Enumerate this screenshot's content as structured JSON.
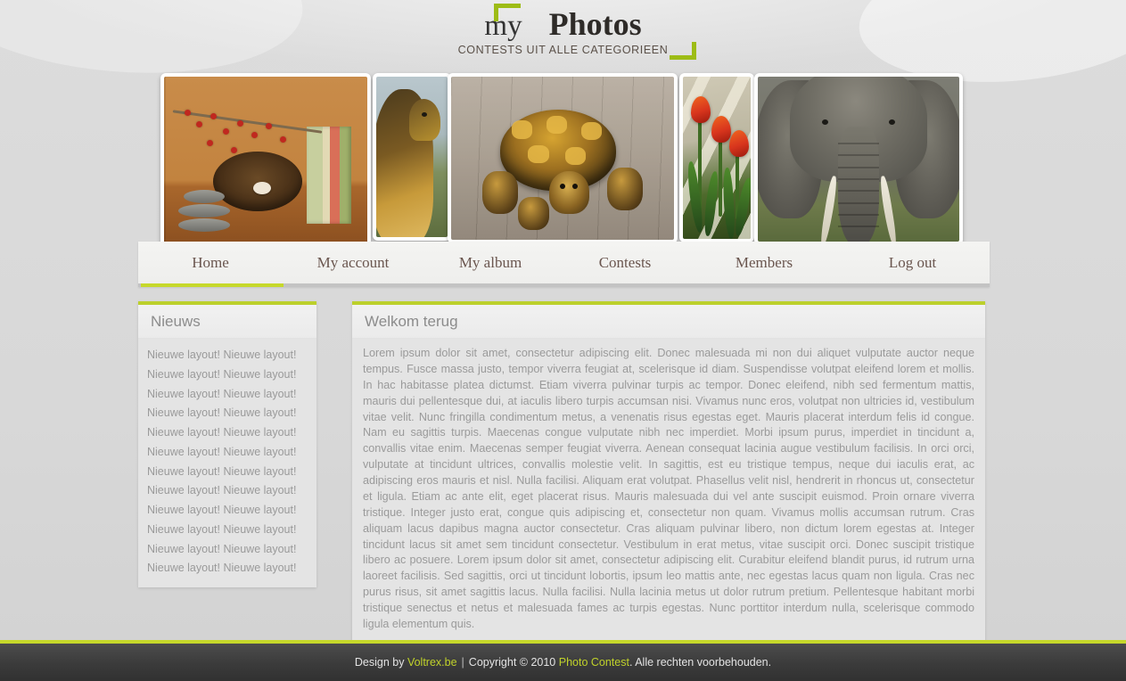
{
  "site": {
    "logo_my": "my",
    "logo_main": "Photos",
    "tagline": "CONTESTS UIT ALLE CATEGORIEEN",
    "accent_green": "#c6d82b",
    "panel_green": "#bcd02c",
    "background": "#d6d6d6",
    "footer_bg": "#3b3b3b"
  },
  "gallery": {
    "photos": [
      {
        "name": "photo-nest",
        "caption": "Bird nest with berries and books on wooden shelf"
      },
      {
        "name": "photo-dog",
        "caption": "Golden long-haired dog in a field"
      },
      {
        "name": "photo-turtle",
        "caption": "Tortoise walking on weathered wooden deck"
      },
      {
        "name": "photo-tulips",
        "caption": "Orange red tulips in front of a fence"
      },
      {
        "name": "photo-elephant",
        "caption": "Close up of an African elephant"
      }
    ]
  },
  "nav": {
    "active": "Home",
    "items": [
      {
        "label": "Home",
        "active": true
      },
      {
        "label": "My account",
        "active": false
      },
      {
        "label": "My album",
        "active": false
      },
      {
        "label": "Contests",
        "active": false
      },
      {
        "label": "Members",
        "active": false
      },
      {
        "label": "Log out",
        "active": false
      }
    ]
  },
  "sidebar": {
    "title": "Nieuws",
    "items": [
      "Nieuwe layout! Nieuwe layout!",
      "Nieuwe layout! Nieuwe layout!",
      "Nieuwe layout! Nieuwe layout!",
      "Nieuwe layout! Nieuwe layout!",
      "Nieuwe layout! Nieuwe layout!",
      "Nieuwe layout! Nieuwe layout!",
      "Nieuwe layout! Nieuwe layout!",
      "Nieuwe layout! Nieuwe layout!",
      "Nieuwe layout! Nieuwe layout!",
      "Nieuwe layout! Nieuwe layout!",
      "Nieuwe layout! Nieuwe layout!",
      "Nieuwe layout! Nieuwe layout!"
    ]
  },
  "content": {
    "title": "Welkom terug",
    "body": "Lorem ipsum dolor sit amet, consectetur adipiscing elit. Donec malesuada mi non dui aliquet vulputate auctor neque tempus. Fusce massa justo, tempor viverra feugiat at, scelerisque id diam. Suspendisse volutpat eleifend lorem et mollis. In hac habitasse platea dictumst. Etiam viverra pulvinar turpis ac tempor. Donec eleifend, nibh sed fermentum mattis, mauris dui pellentesque dui, at iaculis libero turpis accumsan nisi. Vivamus nunc eros, volutpat non ultricies id, vestibulum vitae velit. Nunc fringilla condimentum metus, a venenatis risus egestas eget. Mauris placerat interdum felis id congue. Nam eu sagittis turpis. Maecenas congue vulputate nibh nec imperdiet. Morbi ipsum purus, imperdiet in tincidunt a, convallis vitae enim. Maecenas semper feugiat viverra. Aenean consequat lacinia augue vestibulum facilisis. In orci orci, vulputate at tincidunt ultrices, convallis molestie velit. In sagittis, est eu tristique tempus, neque dui iaculis erat, ac adipiscing eros mauris et nisl. Nulla facilisi. Aliquam erat volutpat. Phasellus velit nisl, hendrerit in rhoncus ut, consectetur et ligula. Etiam ac ante elit, eget placerat risus. Mauris malesuada dui vel ante suscipit euismod. Proin ornare viverra tristique. Integer justo erat, congue quis adipiscing et, consectetur non quam. Vivamus mollis accumsan rutrum. Cras aliquam lacus dapibus magna auctor consectetur. Cras aliquam pulvinar libero, non dictum lorem egestas at. Integer tincidunt lacus sit amet sem tincidunt consectetur. Vestibulum in erat metus, vitae suscipit orci. Donec suscipit tristique libero ac posuere. Lorem ipsum dolor sit amet, consectetur adipiscing elit. Curabitur eleifend blandit purus, id rutrum urna laoreet facilisis. Sed sagittis, orci ut tincidunt lobortis, ipsum leo mattis ante, nec egestas lacus quam non ligula. Cras nec purus risus, sit amet sagittis lacus. Nulla facilisi. Nulla lacinia metus ut dolor rutrum pretium. Pellentesque habitant morbi tristique senectus et netus et malesuada fames ac turpis egestas. Nunc porttitor interdum nulla, scelerisque commodo ligula elementum quis."
  },
  "footer": {
    "design_by": "Design by ",
    "designer": "Voltrex.be",
    "separator": "|",
    "copyright": "Copyright © 2010 ",
    "brand": "Photo Contest",
    "rights": ". Alle rechten voorbehouden."
  }
}
